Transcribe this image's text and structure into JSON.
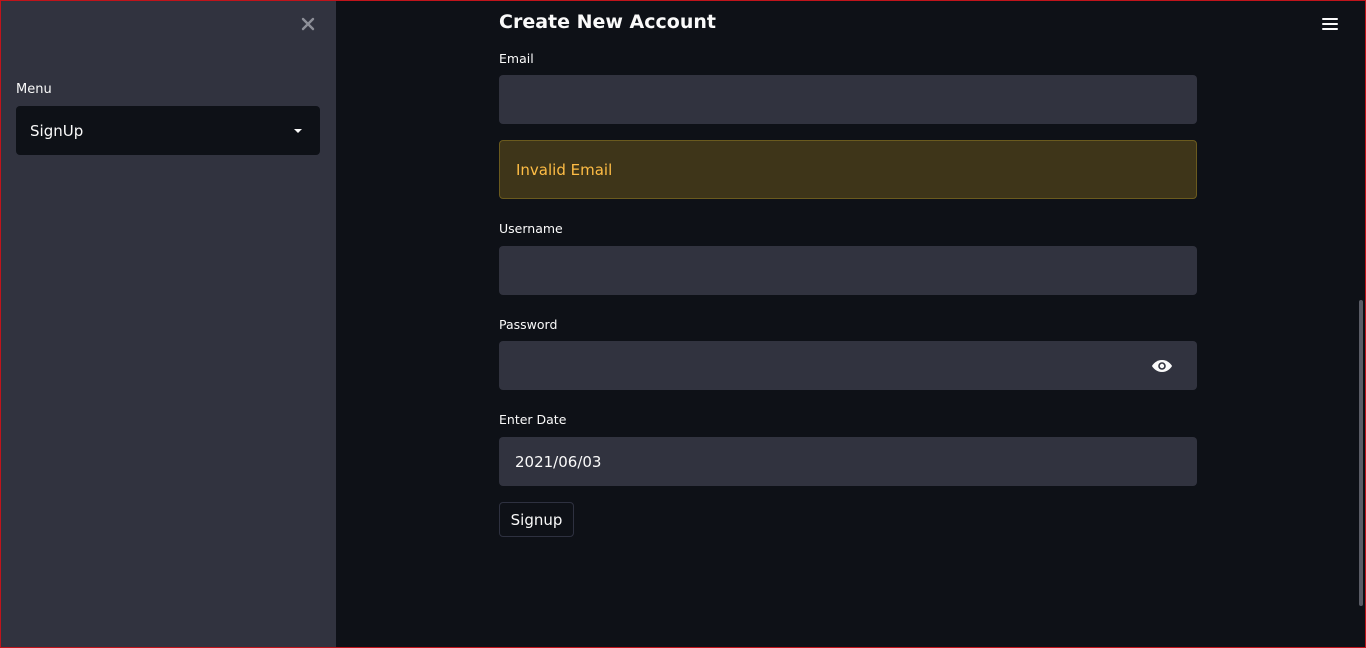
{
  "sidebar": {
    "close_icon": "close-icon",
    "menu_label": "Menu",
    "select": {
      "value": "SignUp",
      "icon": "caret-down-icon"
    }
  },
  "header": {
    "menu_icon": "hamburger-icon"
  },
  "form": {
    "title": "Create New Account",
    "email": {
      "label": "Email",
      "value": ""
    },
    "alert": {
      "text": "Invalid Email",
      "color": "#ffbd45"
    },
    "username": {
      "label": "Username",
      "value": ""
    },
    "password": {
      "label": "Password",
      "value": "",
      "icon": "eye-icon"
    },
    "date": {
      "label": "Enter Date",
      "value": "2021/06/03"
    },
    "submit_label": "Signup"
  },
  "colors": {
    "background": "#0e1117",
    "sidebar": "#31333f",
    "input": "#31333f",
    "warning_bg": "#3e3519",
    "warning_text": "#ffbd45"
  }
}
